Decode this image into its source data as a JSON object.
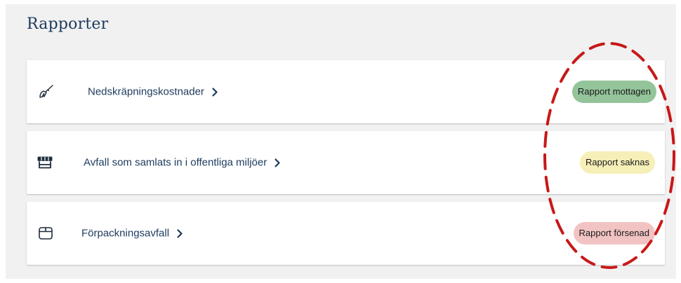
{
  "page": {
    "title": "Rapporter"
  },
  "reports": [
    {
      "label": "Nedskräpningskostnader",
      "icon": "broom-icon",
      "status": "Rapport mottagen",
      "status_color": "#93c49a"
    },
    {
      "label": "Avfall som samlats in i offentliga miljöer",
      "icon": "market-stall-icon",
      "status": "Rapport saknas",
      "status_color": "#f6efb8"
    },
    {
      "label": "Förpackningsavfall",
      "icon": "package-icon",
      "status": "Rapport försenad",
      "status_color": "#f2c3c3"
    }
  ],
  "annotation": {
    "shape": "dashed ellipse",
    "color": "#c81818"
  },
  "colors": {
    "text_primary": "#1c3a5c",
    "panel_background": "#f1f1f1",
    "card_background": "#ffffff"
  }
}
